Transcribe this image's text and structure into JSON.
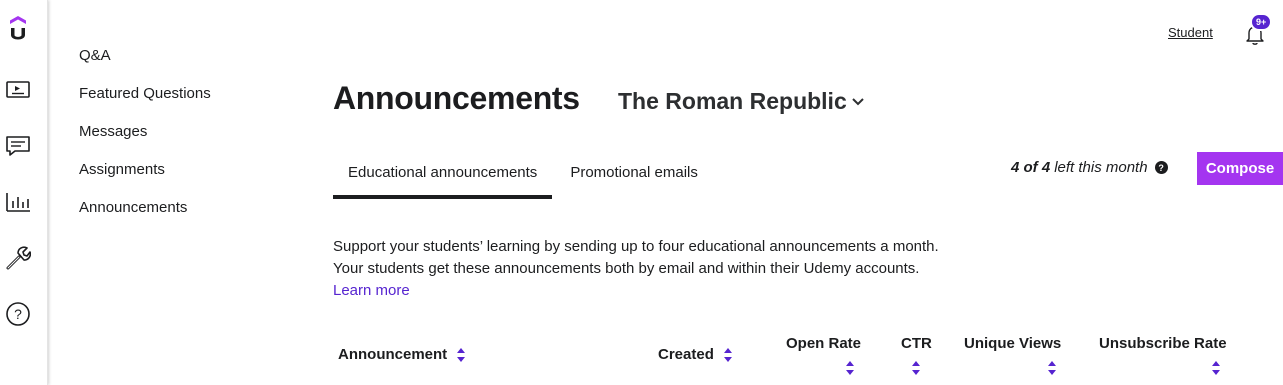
{
  "rail": {
    "logo": "udemy-logo-icon",
    "items": [
      {
        "name": "courses-icon"
      },
      {
        "name": "communication-icon"
      },
      {
        "name": "performance-icon"
      },
      {
        "name": "tools-icon"
      },
      {
        "name": "help-icon"
      }
    ]
  },
  "subnav": {
    "items": [
      {
        "label": "Q&A"
      },
      {
        "label": "Featured Questions"
      },
      {
        "label": "Messages"
      },
      {
        "label": "Assignments"
      },
      {
        "label": "Announcements"
      }
    ]
  },
  "header": {
    "student_link": "Student",
    "notification_badge": "9+"
  },
  "page": {
    "title": "Announcements",
    "course": "The Roman Republic"
  },
  "tabs": [
    {
      "label": "Educational announcements",
      "active": true
    },
    {
      "label": "Promotional emails",
      "active": false
    }
  ],
  "quota": {
    "count": "4 of 4",
    "suffix": "left this month"
  },
  "compose_label": "Compose",
  "description": {
    "text": "Support your students’ learning by sending up to four educational announcements a month. Your students get these announcements both by email and within their Udemy accounts.",
    "link": "Learn more"
  },
  "table": {
    "columns": [
      {
        "label": "Announcement"
      },
      {
        "label": "Created"
      },
      {
        "label": "Open Rate"
      },
      {
        "label": "CTR"
      },
      {
        "label": "Unique Views"
      },
      {
        "label": "Unsubscribe Rate"
      }
    ]
  },
  "colors": {
    "accent_purple": "#a435f0",
    "link_purple": "#5624d0",
    "text": "#1c1d1f"
  }
}
